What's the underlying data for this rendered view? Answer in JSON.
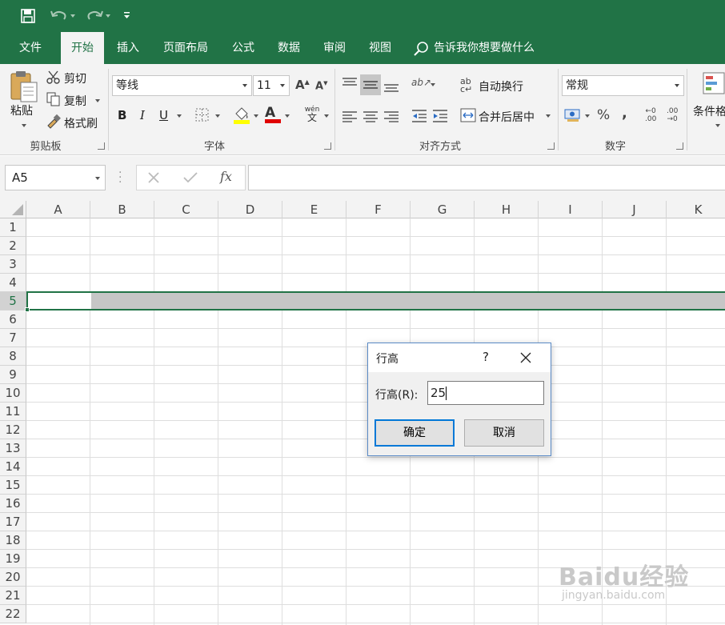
{
  "quick_access": {
    "save_icon": "save-icon",
    "undo_icon": "undo-icon",
    "redo_icon": "redo-icon",
    "customize_icon": "customize-qat-icon"
  },
  "tabs": [
    "文件",
    "开始",
    "插入",
    "页面布局",
    "公式",
    "数据",
    "审阅",
    "视图"
  ],
  "active_tab": "开始",
  "tell_me": "告诉我你想要做什么",
  "clipboard": {
    "paste": "粘贴",
    "cut": "剪切",
    "copy": "复制",
    "format_painter": "格式刷",
    "group": "剪贴板"
  },
  "font": {
    "name": "等线",
    "size": "11",
    "bold": "B",
    "italic": "I",
    "underline": "U",
    "fill_color": "#ffff00",
    "font_color": "#e00000",
    "group": "字体",
    "phonetic_top": "wén",
    "phonetic_bottom": "文"
  },
  "alignment": {
    "wrap_text": "自动换行",
    "merge_center": "合并后居中",
    "group": "对齐方式"
  },
  "number": {
    "format": "常规",
    "percent": "%",
    "comma": ",",
    "inc_decimal_top": "←0",
    "inc_decimal_bottom": ".00",
    "dec_decimal_top": ".00",
    "dec_decimal_bottom": "→0",
    "group": "数字"
  },
  "styles": {
    "conditional": "条件格"
  },
  "formula_bar": {
    "name_box": "A5",
    "fx": "fx",
    "value": ""
  },
  "columns": [
    "A",
    "B",
    "C",
    "D",
    "E",
    "F",
    "G",
    "H",
    "I",
    "J",
    "K"
  ],
  "rows": [
    "1",
    "2",
    "3",
    "4",
    "5",
    "6",
    "7",
    "8",
    "9",
    "10",
    "11",
    "12",
    "13",
    "14",
    "15",
    "16",
    "17",
    "18",
    "19",
    "20",
    "21",
    "22"
  ],
  "selected_row": "5",
  "dialog": {
    "title": "行高",
    "help": "?",
    "field_label": "行高(R):",
    "field_value": "25",
    "ok": "确定",
    "cancel": "取消"
  },
  "watermark": {
    "brand": "Baidu经验",
    "url": "jingyan.baidu.com"
  },
  "colors": {
    "accent": "#217346",
    "selection": "#c6c6c6",
    "dialog_border": "#5a8ac6",
    "default_button": "#0078d7"
  }
}
